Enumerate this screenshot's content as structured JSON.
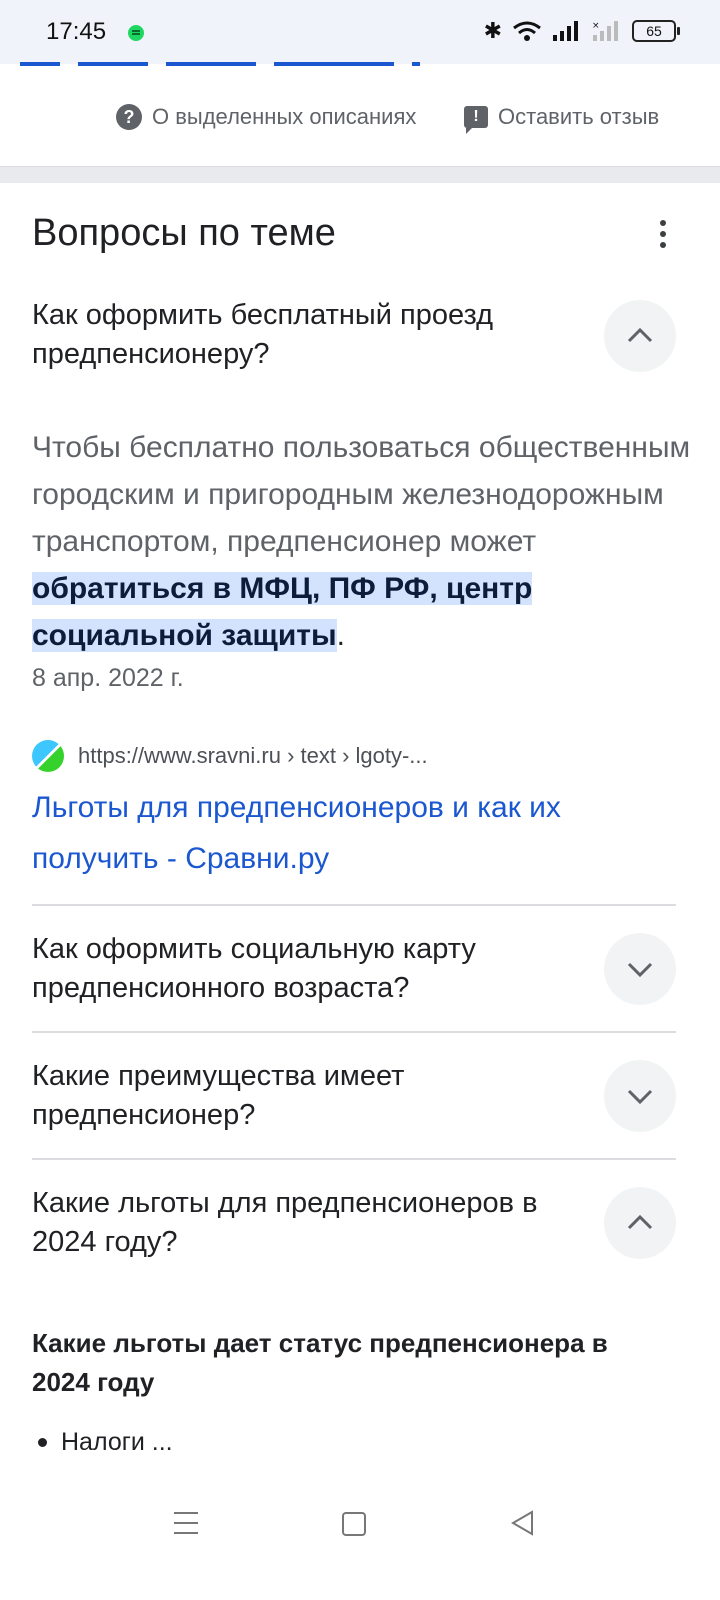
{
  "status_bar": {
    "time": "17:45",
    "battery": "65"
  },
  "feedback_row": {
    "about_label": "О выделенных описаниях",
    "feedback_label": "Оставить отзыв"
  },
  "related_questions": {
    "title": "Вопросы по теме",
    "expanded": {
      "question": "Как оформить бесплатный проезд предпенсионеру?",
      "answer_plain": "Чтобы бесплатно пользоваться общественным городским и пригородным железнодорожным транспортом, предпенсионер может ",
      "answer_highlight": "обратиться в МФЦ, ПФ РФ, центр социальной защиты",
      "answer_end": ".",
      "date": "8 апр. 2022 г.",
      "source_url": "https://www.sravni.ru › text › lgoty-...",
      "source_title": "Льготы для предпенсионеров и как их получить - Сравни.ру"
    },
    "items": [
      {
        "question": "Как оформить социальную карту предпенсионного возраста?"
      },
      {
        "question": "Какие преимущества имеет предпенсионер?"
      },
      {
        "question": "Какие льготы для предпенсионеров в 2024 году?"
      }
    ],
    "last_expanded": {
      "heading": "Какие льготы дает статус предпенсионера в 2024 году",
      "bullet": "Налоги ..."
    }
  }
}
